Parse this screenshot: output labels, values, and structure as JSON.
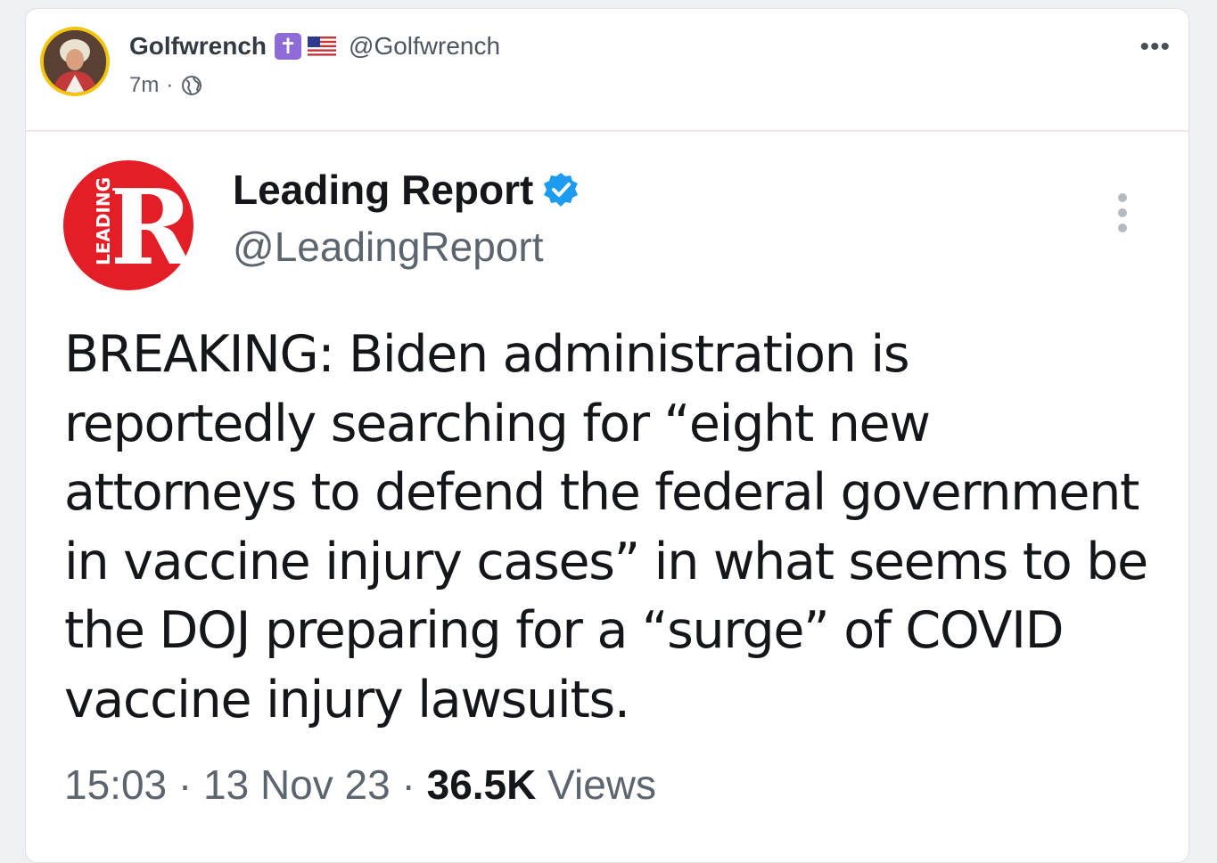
{
  "post": {
    "author": {
      "display_name": "Golfwrench",
      "badges": [
        "cross-icon",
        "us-flag-icon"
      ],
      "handle": "@Golfwrench"
    },
    "time_ago": "7m",
    "separator": "·",
    "visibility_icon": "globe-icon",
    "menu_icon": "more-horizontal-icon",
    "menu_label": "•••"
  },
  "embedded_tweet": {
    "logo_text": "LEADING",
    "logo_letter": "R",
    "account_name": "Leading Report",
    "verified_icon": "verified-badge-icon",
    "handle": "@LeadingReport",
    "menu_icon": "more-vertical-icon",
    "text": "BREAKING: Biden administration is reportedly searching for “eight new attorneys to defend the federal government in vaccine injury cases” in what seems to be the DOJ preparing for a “surge” of COVID vaccine injury lawsuits.",
    "time": "15:03",
    "date": "13 Nov 23",
    "separator": " · ",
    "views_count": "36.5K",
    "views_label": "Views"
  },
  "colors": {
    "page_background": "#eef0f3",
    "avatar_ring": "#f2c40f",
    "cross_badge": "#8e6bd6",
    "logo_red": "#e41e26",
    "verified_blue": "#1d9bf0"
  }
}
